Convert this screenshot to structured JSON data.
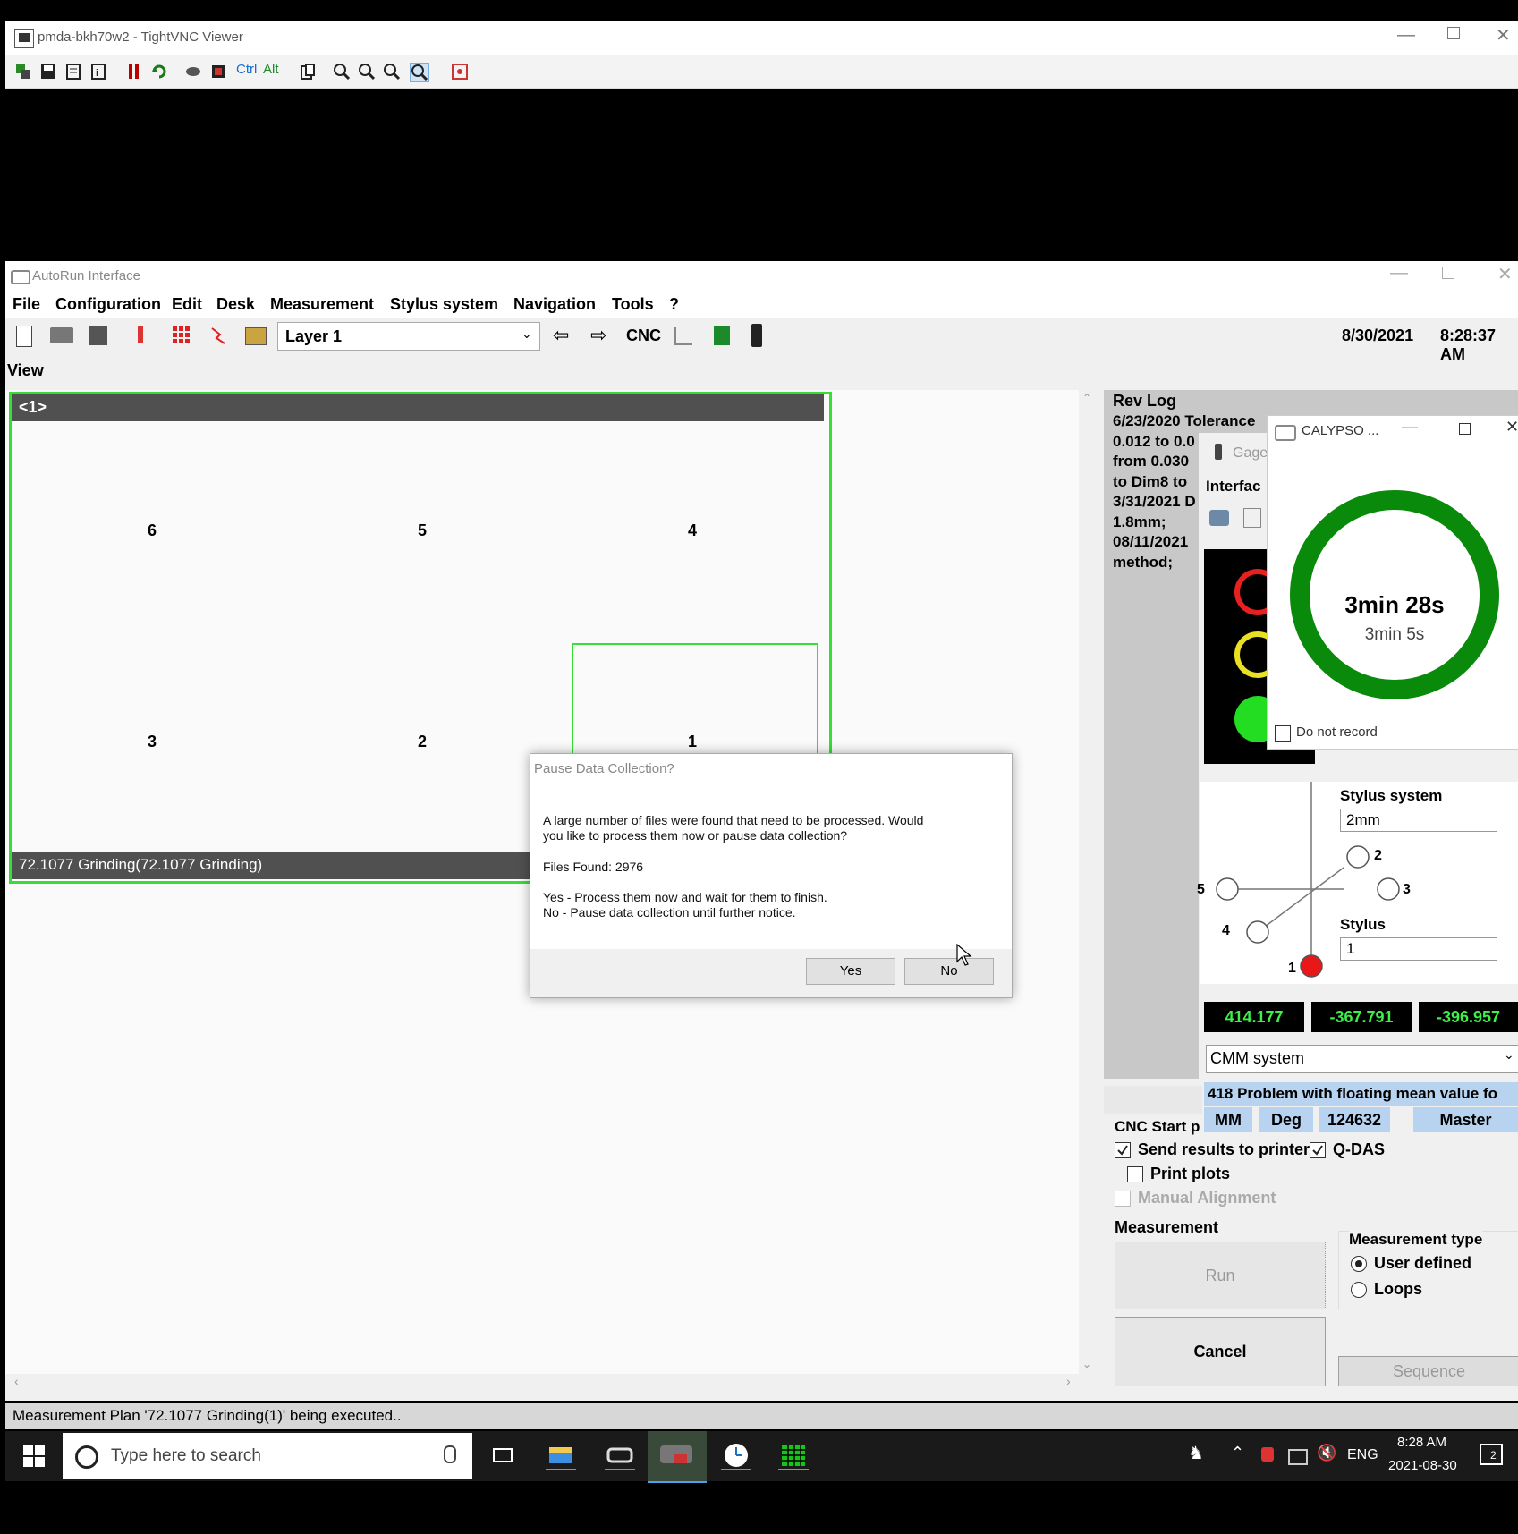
{
  "vnc": {
    "title": "pmda-bkh70w2 - TightVNC Viewer",
    "toolbar_text_ctrl": "Ctrl",
    "toolbar_text_alt": "Alt"
  },
  "autorun": {
    "title": "AutoRun Interface",
    "menu": [
      "File",
      "Configuration",
      "Edit",
      "Desk",
      "Measurement",
      "Stylus system",
      "Navigation",
      "Tools",
      "?"
    ],
    "layer_select": "Layer 1",
    "cnc_label": "CNC",
    "date": "8/30/2021",
    "time": "8:28:37 AM",
    "view_label": "View",
    "plan_header": "<1>",
    "cells": [
      "6",
      "5",
      "4",
      "3",
      "2",
      "1"
    ],
    "plan_footer": "72.1077 Grinding(72.1077 Grinding)",
    "status_bar": "Measurement Plan '72.1077 Grinding(1)' being executed.."
  },
  "dialog": {
    "title": "Pause Data Collection?",
    "line1": "A large number of files were found that need to be processed. Would",
    "line2": "you like to process them now or pause data collection?",
    "files_found": "Files Found: 2976",
    "yes_text": "Yes - Process them now and wait for them to finish.",
    "no_text": "No - Pause data collection until further notice.",
    "yes_button": "Yes",
    "no_button": "No"
  },
  "rev_log": {
    "title": "Rev Log",
    "lines": [
      "6/23/2020 Tolerance",
      "0.012 to 0.0",
      "from 0.030",
      "to Dim8 to",
      "3/31/2021 D",
      "1.8mm;",
      "08/11/2021",
      "method;"
    ]
  },
  "gage": {
    "title_partial": "Gage",
    "interface_partial": "Interfac",
    "stylus_system_label": "Stylus system",
    "stylus_system_value": "2mm",
    "stylus_label": "Stylus",
    "stylus_value": "1",
    "probe_labels": [
      "1",
      "2",
      "3",
      "4",
      "5"
    ],
    "coords": [
      "414.177",
      "-367.791",
      "-396.957"
    ],
    "coord_system": "CMM system",
    "message": "418 Problem with floating mean value fo",
    "units": [
      "MM",
      "Deg",
      "124632",
      "Master"
    ],
    "coord_color": "#3cf04a"
  },
  "calypso": {
    "title": "CALYPSO ...",
    "time_main": "3min 28s",
    "time_sub": "3min 5s",
    "do_not_record": "Do not record",
    "ring_color": "#0a8a0a"
  },
  "cnc_panel": {
    "title_partial": "CNC Start p",
    "send_results": "Send results to printer",
    "qdas": "Q-DAS",
    "print_plots": "Print plots",
    "manual_alignment": "Manual Alignment",
    "measurement_group": "Measurement",
    "run_button": "Run",
    "cancel_button": "Cancel",
    "measurement_type_group": "Measurement type",
    "user_defined": "User defined",
    "loops": "Loops",
    "sequence_button": "Sequence"
  },
  "taskbar": {
    "search_placeholder": "Type here to search",
    "language": "ENG",
    "clock_time": "8:28 AM",
    "clock_date": "2021-08-30",
    "notification_count": "2"
  }
}
